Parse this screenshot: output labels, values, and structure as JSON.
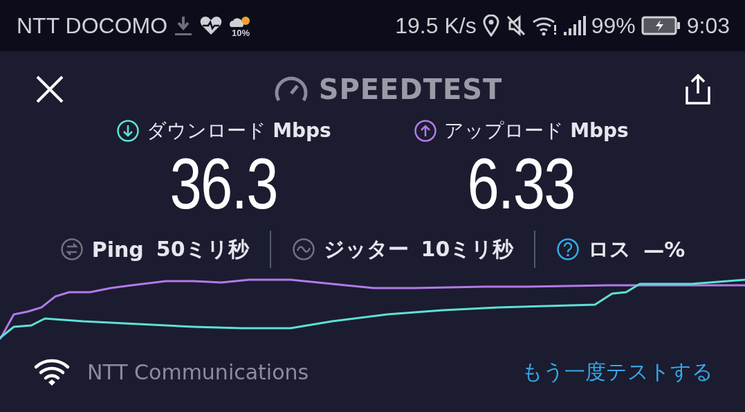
{
  "status_bar": {
    "carrier": "NTT DOCOMO",
    "weather_text": "10%",
    "speed": "19.5 K/s",
    "battery": "99%",
    "time": "9:03"
  },
  "header": {
    "title": "SPEEDTEST"
  },
  "results": [
    {
      "kind": "download",
      "label": "ダウンロード",
      "unit": "Mbps",
      "value": "36.3"
    },
    {
      "kind": "upload",
      "label": "アップロード",
      "unit": "Mbps",
      "value": "6.33"
    }
  ],
  "stats": [
    {
      "kind": "ping",
      "label": "Ping",
      "value": "50ミリ秒"
    },
    {
      "kind": "jitter",
      "label": "ジッター",
      "value": "10ミリ秒"
    },
    {
      "kind": "loss",
      "label": "ロス",
      "value": "—%"
    }
  ],
  "footer": {
    "provider": "NTT Communications",
    "retest": "もう一度テストする"
  }
}
